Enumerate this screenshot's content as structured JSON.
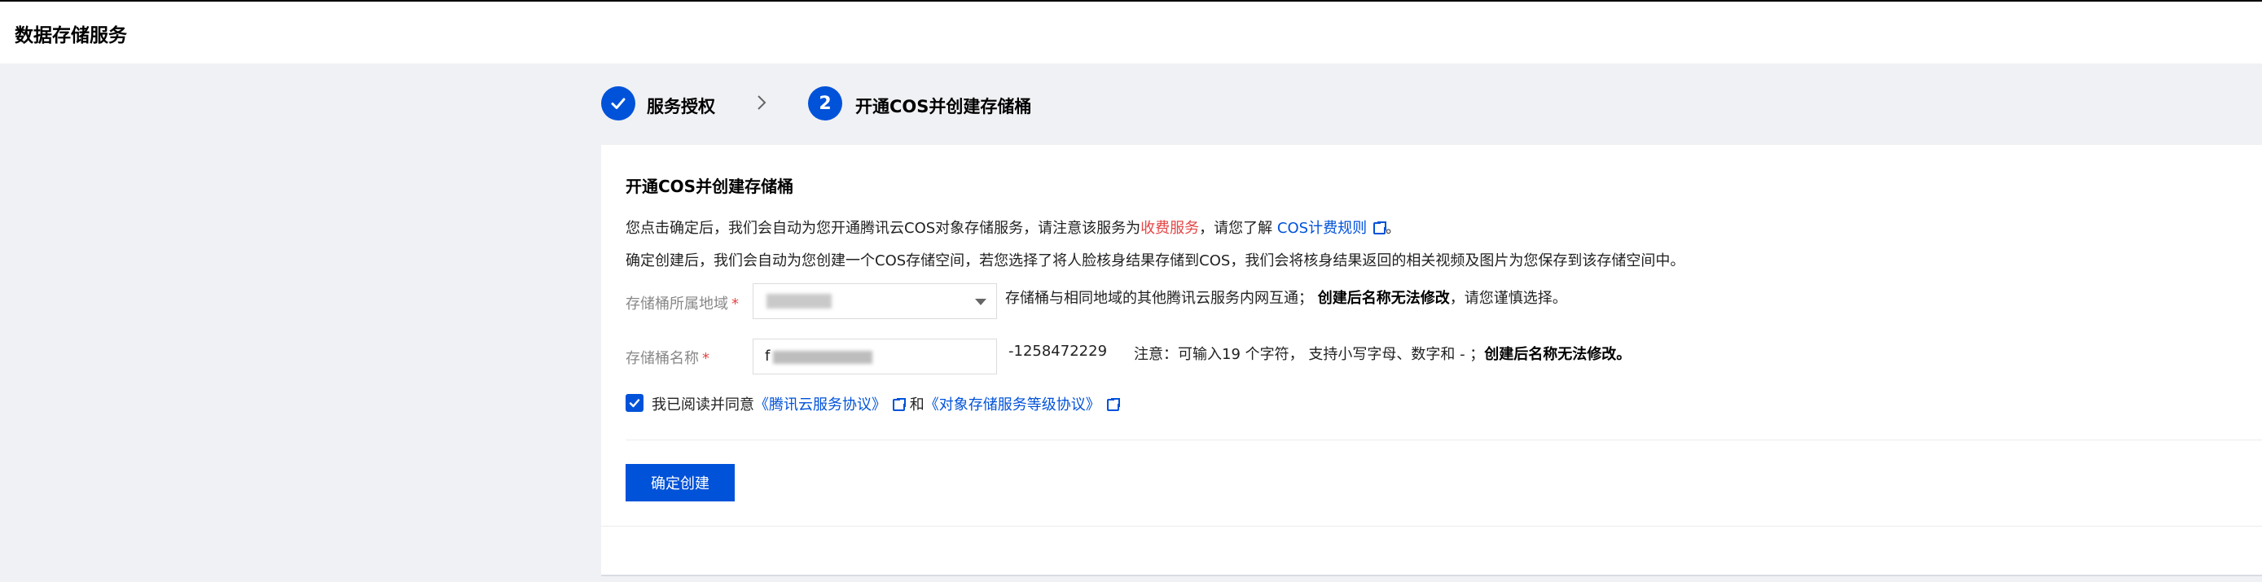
{
  "header": {
    "title": "数据存储服务"
  },
  "steps": [
    {
      "label": "服务授权",
      "status": "done"
    },
    {
      "number": "2",
      "label": "开通COS并创建存储桶",
      "status": "active"
    }
  ],
  "card": {
    "title": "开通COS并创建存储桶",
    "desc1_pre": "您点击确定后，我们会自动为您开通腾讯云COS对象存储服务，请注意该服务为",
    "desc1_red": "收费服务",
    "desc1_mid": "，请您了解",
    "desc1_link": "COS计费规则",
    "desc1_end": "。",
    "desc2": "确定创建后，我们会自动为您创建一个COS存储空间，若您选择了将人脸核身结果存储到COS，我们会将核身结果返回的相关视频及图片为您保存到该存储空间中。",
    "region_label": "存储桶所属地域",
    "region_note": "存储桶与相同地域的其他腾讯云服务内网互通；",
    "region_note_bold": "创建后名称无法修改",
    "region_note_end": "，请您谨慎选择。",
    "name_label": "存储桶名称",
    "name_value_prefix": "f",
    "name_suffix": "-1258472229",
    "name_note": "注意：可输入19 个字符， 支持小写字母、数字和 - ；",
    "name_note_bold": "创建后名称无法修改。",
    "agree_pre": "我已阅读并同意",
    "agree_link1": "《腾讯云服务协议》",
    "agree_and": "和",
    "agree_link2": "《对象存储服务等级协议》",
    "agreed": true,
    "confirm_label": "确定创建"
  },
  "colors": {
    "primary": "#0052d9",
    "danger": "#e54545",
    "background": "#f0f1f4"
  }
}
